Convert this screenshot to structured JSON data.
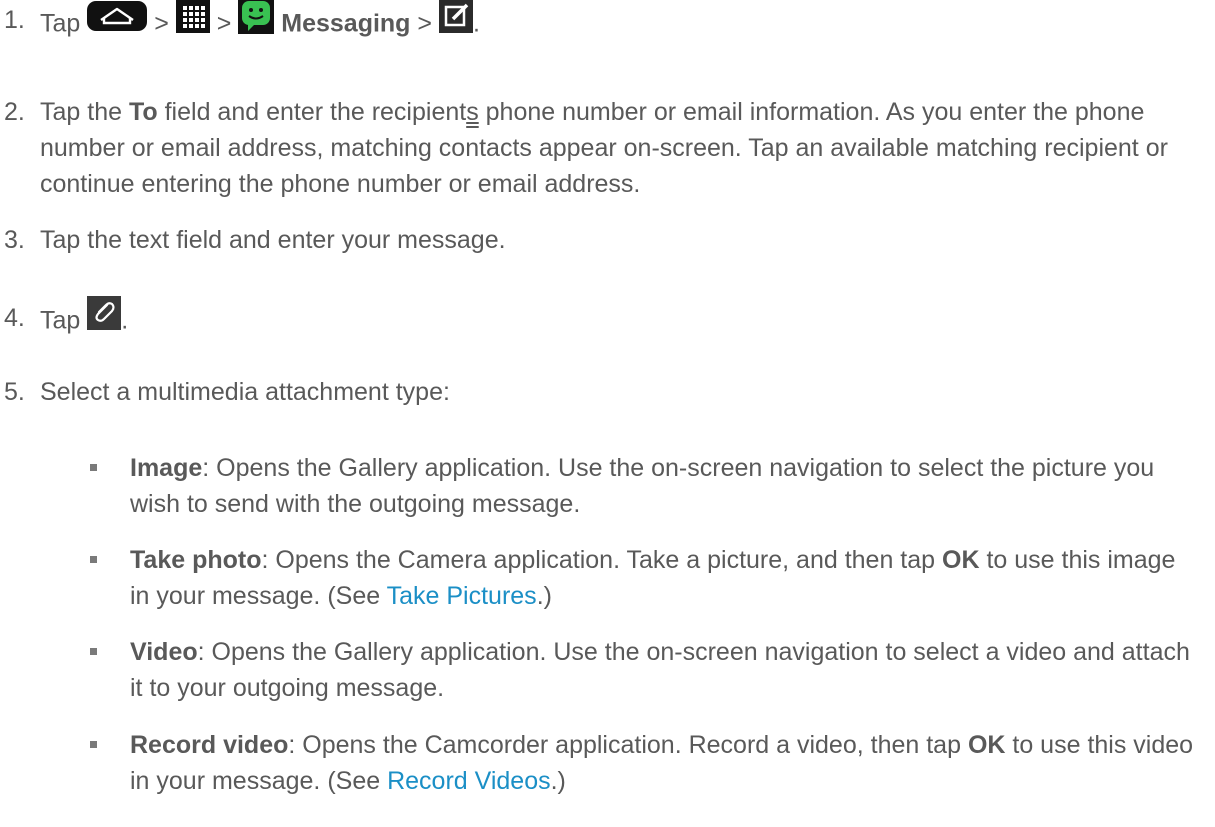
{
  "steps": [
    {
      "num": "1.",
      "tap": "Tap",
      "sep": ">",
      "messaging": "Messaging",
      "end": "."
    },
    {
      "num": "2.",
      "pre": "Tap the",
      "bold": "To",
      "mid": "field and enter the recipient",
      "s": "s",
      "post": "phone number or email information. As you enter the phone number or email address, matching contacts appear on-screen. Tap an available matching recipient or continue entering the phone number or email address."
    },
    {
      "num": "3.",
      "text": "Tap the text field and enter your message."
    },
    {
      "num": "4.",
      "tap": "Tap",
      "end": "."
    },
    {
      "num": "5.",
      "text": "Select a multimedia attachment type:"
    }
  ],
  "bullets": [
    {
      "term": "Image",
      "text": ": Opens the Gallery application. Use the on-screen navigation to select the picture you wish to send with the outgoing message."
    },
    {
      "term": "Take photo",
      "text1": ": Opens the Camera application. Take a picture, and then tap",
      "ok": "OK",
      "text2": "to use this image in your message. (See",
      "link": "Take Pictures",
      "text3": ".)"
    },
    {
      "term": "Video",
      "text": ": Opens the Gallery application. Use the on-screen navigation to select a video and attach it to your outgoing message."
    },
    {
      "term": "Record video",
      "text1": ": Opens the Camcorder application. Record a video, then tap",
      "ok": "OK",
      "text2": "to use this video in your message. (See",
      "link": "Record Videos",
      "text3": ".)"
    }
  ],
  "icons": {
    "home": "home-icon",
    "apps": "apps-grid-icon",
    "messaging": "messaging-app-icon",
    "compose": "compose-icon",
    "attach": "paperclip-attach-icon"
  },
  "colors": {
    "text": "#595959",
    "link": "#1b8fc6",
    "messaging_green": "#39c152"
  }
}
